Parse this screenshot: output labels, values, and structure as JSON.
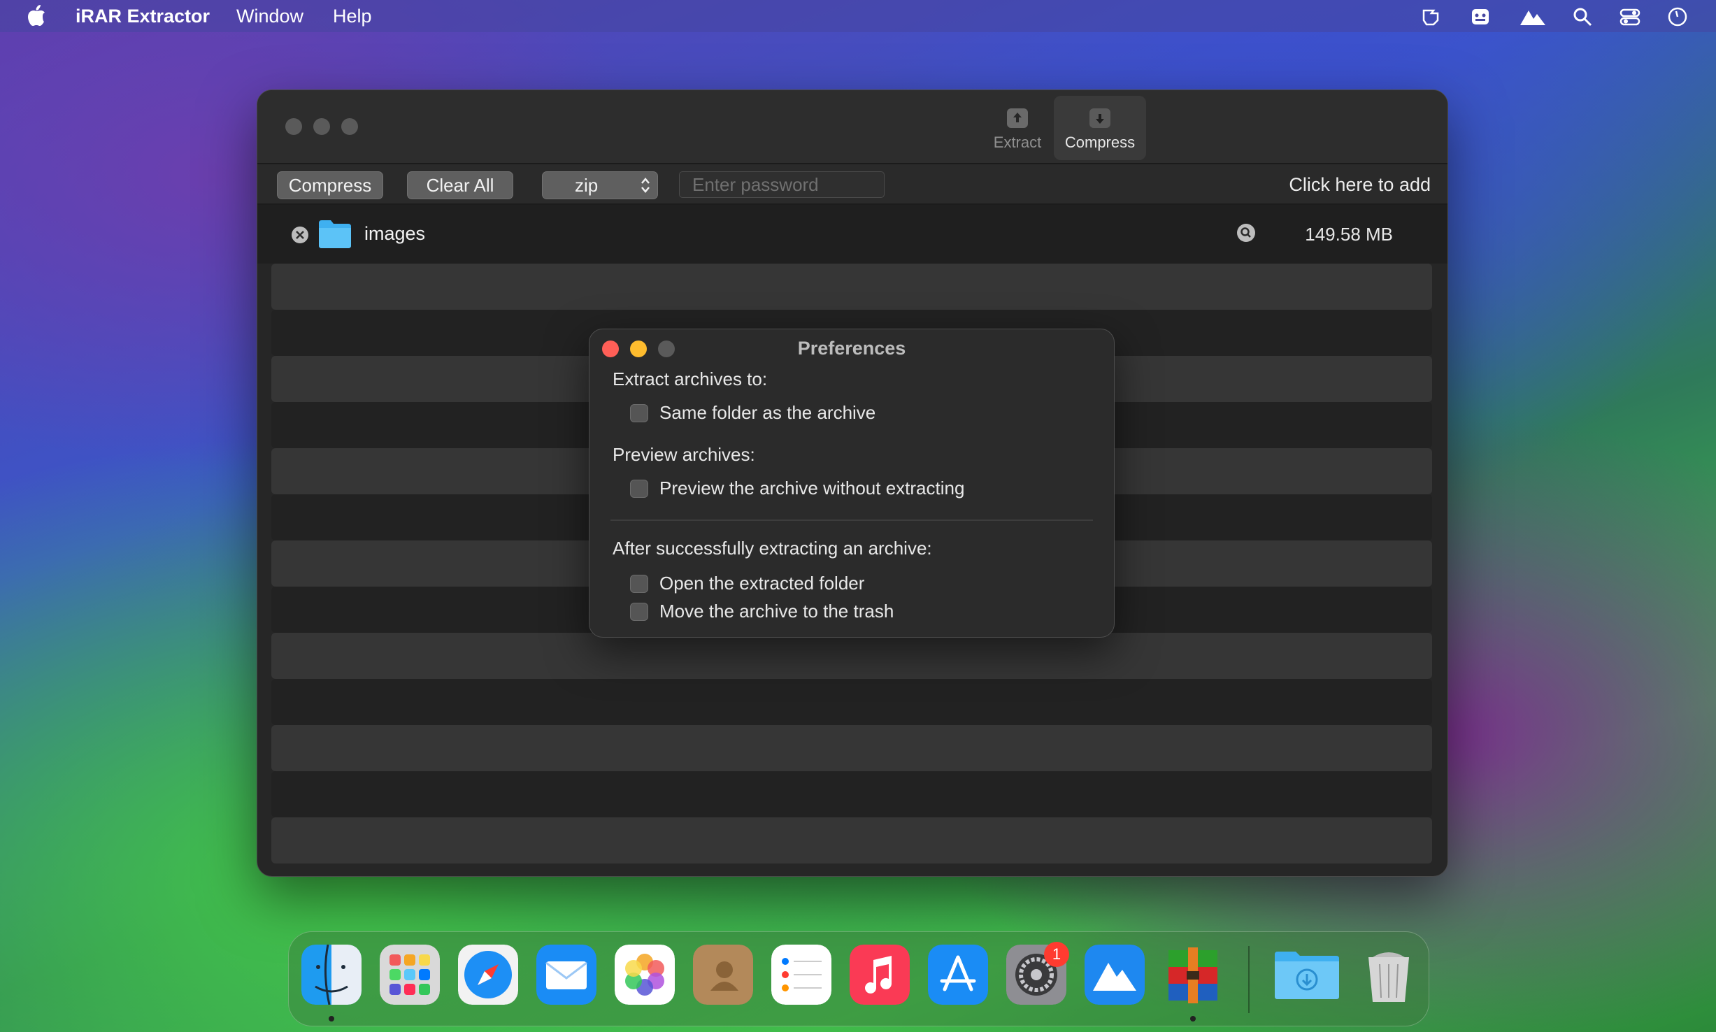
{
  "menubar": {
    "app_name": "iRAR Extractor",
    "items": [
      "Window",
      "Help"
    ],
    "status_icons": [
      "share-icon",
      "toolbox-icon",
      "mountain-icon",
      "spotlight-icon",
      "control-center-icon",
      "clock-icon"
    ]
  },
  "window": {
    "tabs": [
      {
        "label": "Extract",
        "icon": "extract-icon"
      },
      {
        "label": "Compress",
        "icon": "compress-icon"
      }
    ],
    "toolbar": {
      "compress_label": "Compress",
      "clear_all_label": "Clear All",
      "format_value": "zip",
      "password_placeholder": "Enter password",
      "add_hint": "Click here to add"
    },
    "items": [
      {
        "name": "images",
        "size": "149.58 MB",
        "icon": "folder-icon"
      }
    ]
  },
  "preferences": {
    "title": "Preferences",
    "section_extract": "Extract archives to:",
    "opt_same_folder": "Same folder as the archive",
    "section_preview": "Preview archives:",
    "opt_preview": "Preview the archive without extracting",
    "section_after": "After successfully extracting an archive:",
    "opt_open_folder": "Open the extracted folder",
    "opt_trash": "Move the archive to the trash"
  },
  "dock": {
    "apps": [
      "Finder",
      "Launchpad",
      "Safari",
      "Mail",
      "Photos",
      "Contacts",
      "Reminders",
      "Music",
      "App Store",
      "System Settings",
      "Maps",
      "iRAR Extractor",
      "Downloads",
      "Trash"
    ],
    "settings_badge": "1"
  },
  "colors": {
    "close": "#ff5f57",
    "minimize": "#febc2e",
    "folder_blue": "#3fb0f0",
    "badge_red": "#ff3b30"
  }
}
